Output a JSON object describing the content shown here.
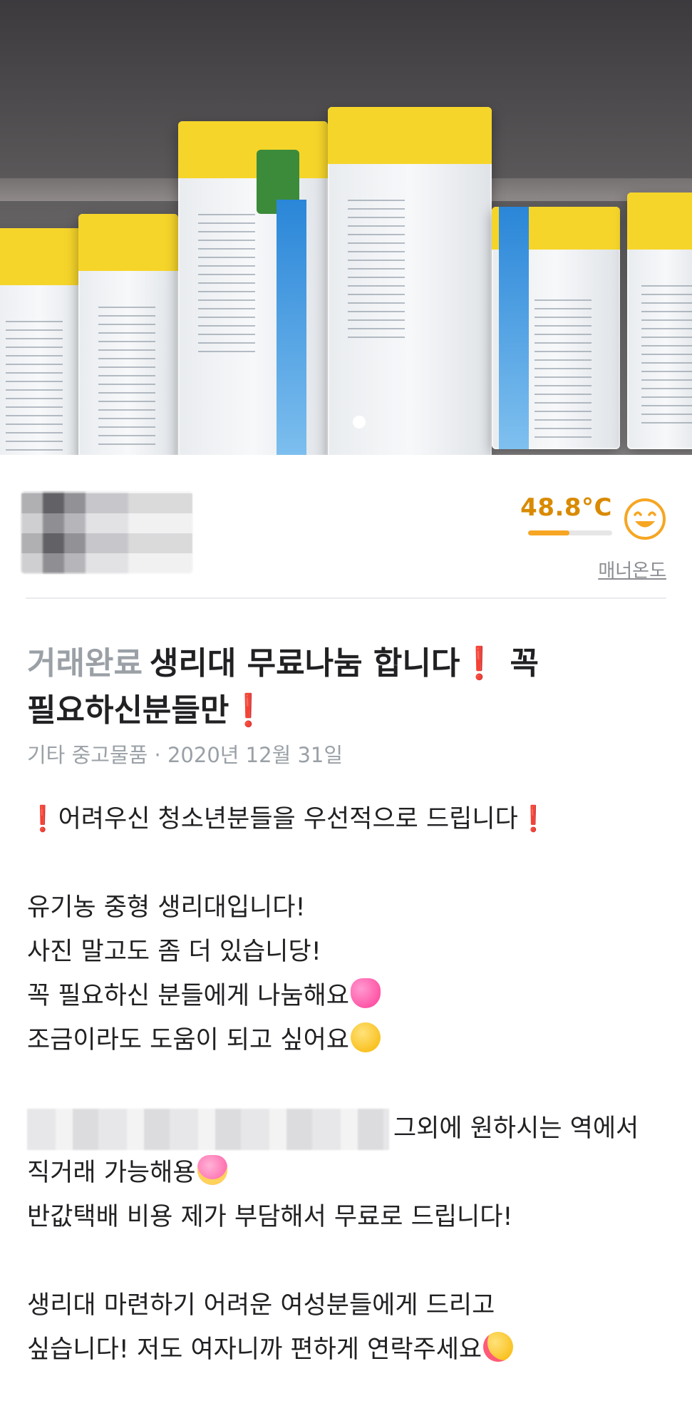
{
  "photo": {
    "alt": "생리대 사진",
    "pagination_count": 1,
    "pagination_active": 0
  },
  "seller": {
    "manner_temp": "48.8°C",
    "manner_temp_fraction": 0.488,
    "manner_label": "매너온도",
    "mood_icon": "smiling-face-icon"
  },
  "post": {
    "status": "거래완료",
    "title_part1": "생리대 무료나눔 합니다",
    "title_part2": "꼭",
    "title_part3": "필요하신분들만",
    "exclamation": "❗",
    "category": "기타 중고물품",
    "separator": "·",
    "date": "2020년 12월 31일",
    "lines": {
      "l1": "어려우신 청소년분들을 우선적으로 드립니다",
      "l2": "유기농 중형 생리대입니다!",
      "l3": "사진 말고도 좀 더 있습니당!",
      "l4": "꼭 필요하신 분들에게 나눔해요",
      "l5": "조금이라도 도움이 되고 싶어요",
      "l6": "그외에 원하시는 역에서",
      "l7": "직거래 가능해용",
      "l8": "반값택배 비용 제가 부담해서 무료로 드립니다!",
      "l9": "생리대 마련하기 어려운 여성분들에게 드리고",
      "l10": "싶습니다! 저도 여자니까 편하게 연락주세요"
    }
  },
  "colors": {
    "temp": "#d98a00",
    "temp_bar": "#f6a623",
    "status": "#9aa0a6",
    "alert": "#e53935"
  }
}
